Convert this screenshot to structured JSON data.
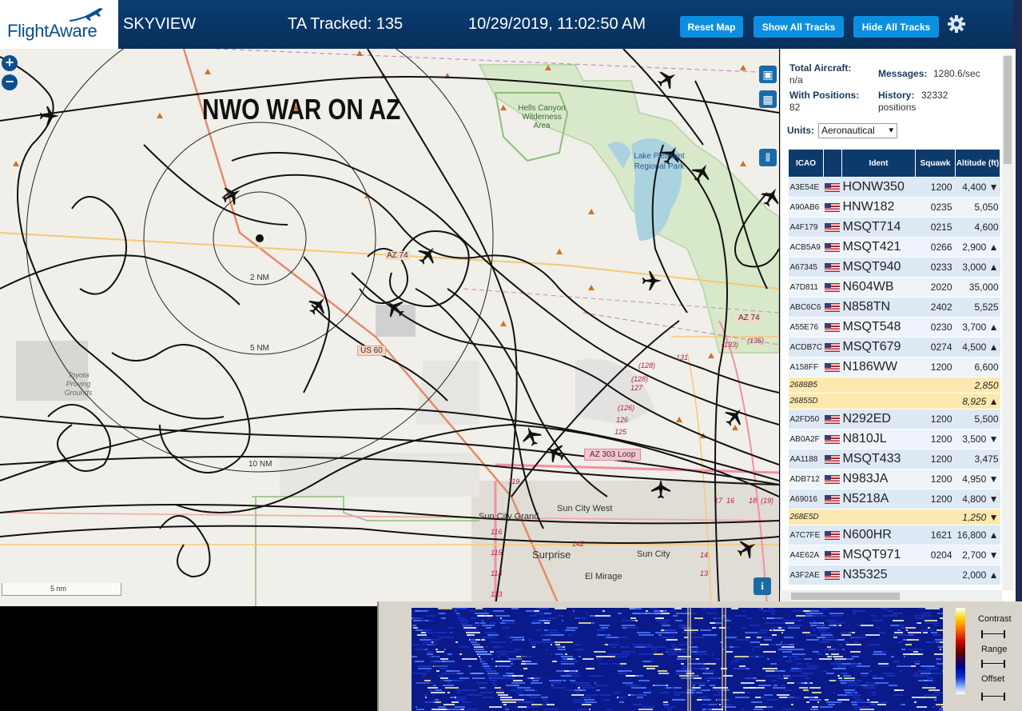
{
  "header": {
    "logo": "FlightAware",
    "app_title": "SKYVIEW",
    "tracked": "TA Tracked: 135",
    "datetime": "10/29/2019, 11:02:50 AM",
    "buttons": {
      "reset": "Reset Map",
      "show": "Show All Tracks",
      "hide": "Hide All Tracks"
    },
    "brand_color": "#0b4f8f",
    "accent_color": "#0d8fe0"
  },
  "map": {
    "overlay_title": "NWO WAR ON AZ",
    "zoom_in": "+",
    "zoom_out": "−",
    "scale_label": "5 nm",
    "info": "i",
    "range_labels": [
      "2 NM",
      "5 NM",
      "10 NM"
    ],
    "road_labels": [
      "AZ 74",
      "US 60",
      "AZ 303 Loop",
      "AZ 74"
    ],
    "places": [
      "Hells Canyon Wilderness Area",
      "Lake Pleasant Regional Park",
      "Toyota Proving Grounds",
      "Sun City Grand",
      "Sun City West",
      "Surprise",
      "Sun City",
      "El Mirage"
    ],
    "mile_markers": [
      "131",
      "(133)",
      "(135)",
      "(128)",
      "(128)",
      "127",
      "(126)",
      "126",
      "125",
      "119",
      "116",
      "115",
      "114",
      "113",
      "142",
      "17",
      "16",
      "18",
      "(19)",
      "14",
      "13"
    ]
  },
  "stats": {
    "total_label": "Total Aircraft:",
    "total_value": "n/a",
    "messages_label": "Messages:",
    "messages_value": "1280.6/sec",
    "positions_label": "With Positions:",
    "positions_value": "82",
    "history_label": "History:",
    "history_value": "32332",
    "history_unit": "positions",
    "units_label": "Units:",
    "units_value": "Aeronautical"
  },
  "table": {
    "headers": [
      "ICAO",
      "",
      "Ident",
      "Squawk",
      "Altitude (ft)"
    ],
    "rows": [
      {
        "icao": "A3E54E",
        "flag": true,
        "ident": "HONW350",
        "squawk": "1200",
        "alt": "4,400 ▼"
      },
      {
        "icao": "A90AB6",
        "flag": true,
        "ident": "HNW182",
        "squawk": "0235",
        "alt": "5,050"
      },
      {
        "icao": "A4F179",
        "flag": true,
        "ident": "MSQT714",
        "squawk": "0215",
        "alt": "4,600"
      },
      {
        "icao": "ACB5A9",
        "flag": true,
        "ident": "MSQT421",
        "squawk": "0266",
        "alt": "2,900 ▲"
      },
      {
        "icao": "A67345",
        "flag": true,
        "ident": "MSQT940",
        "squawk": "0233",
        "alt": "3,000 ▲"
      },
      {
        "icao": "A7D811",
        "flag": true,
        "ident": "N604WB",
        "squawk": "2020",
        "alt": "35,000"
      },
      {
        "icao": "ABC6C6",
        "flag": true,
        "ident": "N858TN",
        "squawk": "2402",
        "alt": "5,525"
      },
      {
        "icao": "A55E76",
        "flag": true,
        "ident": "MSQT548",
        "squawk": "0230",
        "alt": "3,700 ▲"
      },
      {
        "icao": "ACDB7C",
        "flag": true,
        "ident": "MSQT679",
        "squawk": "0274",
        "alt": "4,500 ▲"
      },
      {
        "icao": "A158FF",
        "flag": true,
        "ident": "N186WW",
        "squawk": "1200",
        "alt": "6,600"
      },
      {
        "icao": "2688B5",
        "flag": false,
        "ident": "",
        "squawk": "",
        "alt": "2,850"
      },
      {
        "icao": "26855D",
        "flag": false,
        "ident": "",
        "squawk": "",
        "alt": "8,925 ▲"
      },
      {
        "icao": "A2FD50",
        "flag": true,
        "ident": "N292ED",
        "squawk": "1200",
        "alt": "5,500"
      },
      {
        "icao": "AB0A2F",
        "flag": true,
        "ident": "N810JL",
        "squawk": "1200",
        "alt": "3,500 ▼"
      },
      {
        "icao": "AA1188",
        "flag": true,
        "ident": "MSQT433",
        "squawk": "1200",
        "alt": "3,475"
      },
      {
        "icao": "ADB712",
        "flag": true,
        "ident": "N983JA",
        "squawk": "1200",
        "alt": "4,950 ▼"
      },
      {
        "icao": "A69016",
        "flag": true,
        "ident": "N5218A",
        "squawk": "1200",
        "alt": "4,800 ▼"
      },
      {
        "icao": "268E5D",
        "flag": false,
        "ident": "",
        "squawk": "",
        "alt": "1,250 ▼"
      },
      {
        "icao": "A7C7FE",
        "flag": true,
        "ident": "N600HR",
        "squawk": "1621",
        "alt": "16,800 ▲"
      },
      {
        "icao": "A4E62A",
        "flag": true,
        "ident": "MSQT971",
        "squawk": "0204",
        "alt": "2,700 ▼"
      },
      {
        "icao": "A3F2AE",
        "flag": true,
        "ident": "N35325",
        "squawk": "",
        "alt": "2,000 ▲"
      }
    ]
  },
  "spectrogram": {
    "contrast": "Contrast",
    "range": "Range",
    "offset": "Offset"
  }
}
